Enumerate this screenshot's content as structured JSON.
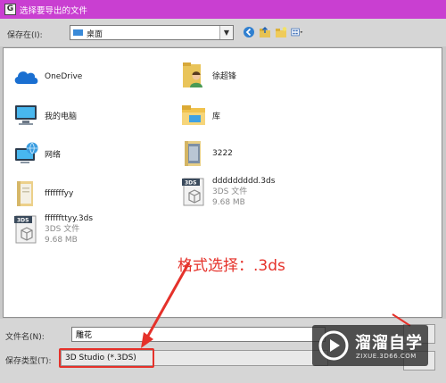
{
  "window": {
    "title": "选择要导出的文件"
  },
  "toolbar": {
    "save_in_label": "保存在(I):",
    "location_value": "桌面",
    "icons": [
      "back-arrow-icon",
      "up-folder-icon",
      "new-folder-icon",
      "view-menu-icon"
    ]
  },
  "files": [
    {
      "name": "OneDrive",
      "icon": "onedrive-cloud-icon"
    },
    {
      "name": "徐超锋",
      "icon": "user-folder-icon"
    },
    {
      "name": "我的电脑",
      "icon": "computer-icon"
    },
    {
      "name": "库",
      "icon": "library-folder-icon"
    },
    {
      "name": "网络",
      "icon": "network-icon"
    },
    {
      "name": "3222",
      "icon": "folder-icon"
    },
    {
      "name": "fffffffyy",
      "icon": "folder-icon"
    },
    {
      "name": "ddddddddd.3ds",
      "type": "3DS 文件",
      "size": "9.68 MB",
      "icon": "3ds-file-icon"
    },
    {
      "name": "ffffffttyy.3ds",
      "type": "3DS 文件",
      "size": "9.68 MB",
      "icon": "3ds-file-icon"
    }
  ],
  "annotation": "格式选择：.3ds",
  "filename": {
    "label": "文件名(N):",
    "value": "雕花"
  },
  "filetype": {
    "label": "保存类型(T):",
    "value": "3D Studio (*.3DS)"
  },
  "watermark": {
    "title": "溜溜自学",
    "subtitle": "ZIXUE.3D66.COM"
  },
  "colors": {
    "titlebar": "#c93fd1",
    "annotation": "#e5312a",
    "folder_blue": "#3a8ad8"
  }
}
